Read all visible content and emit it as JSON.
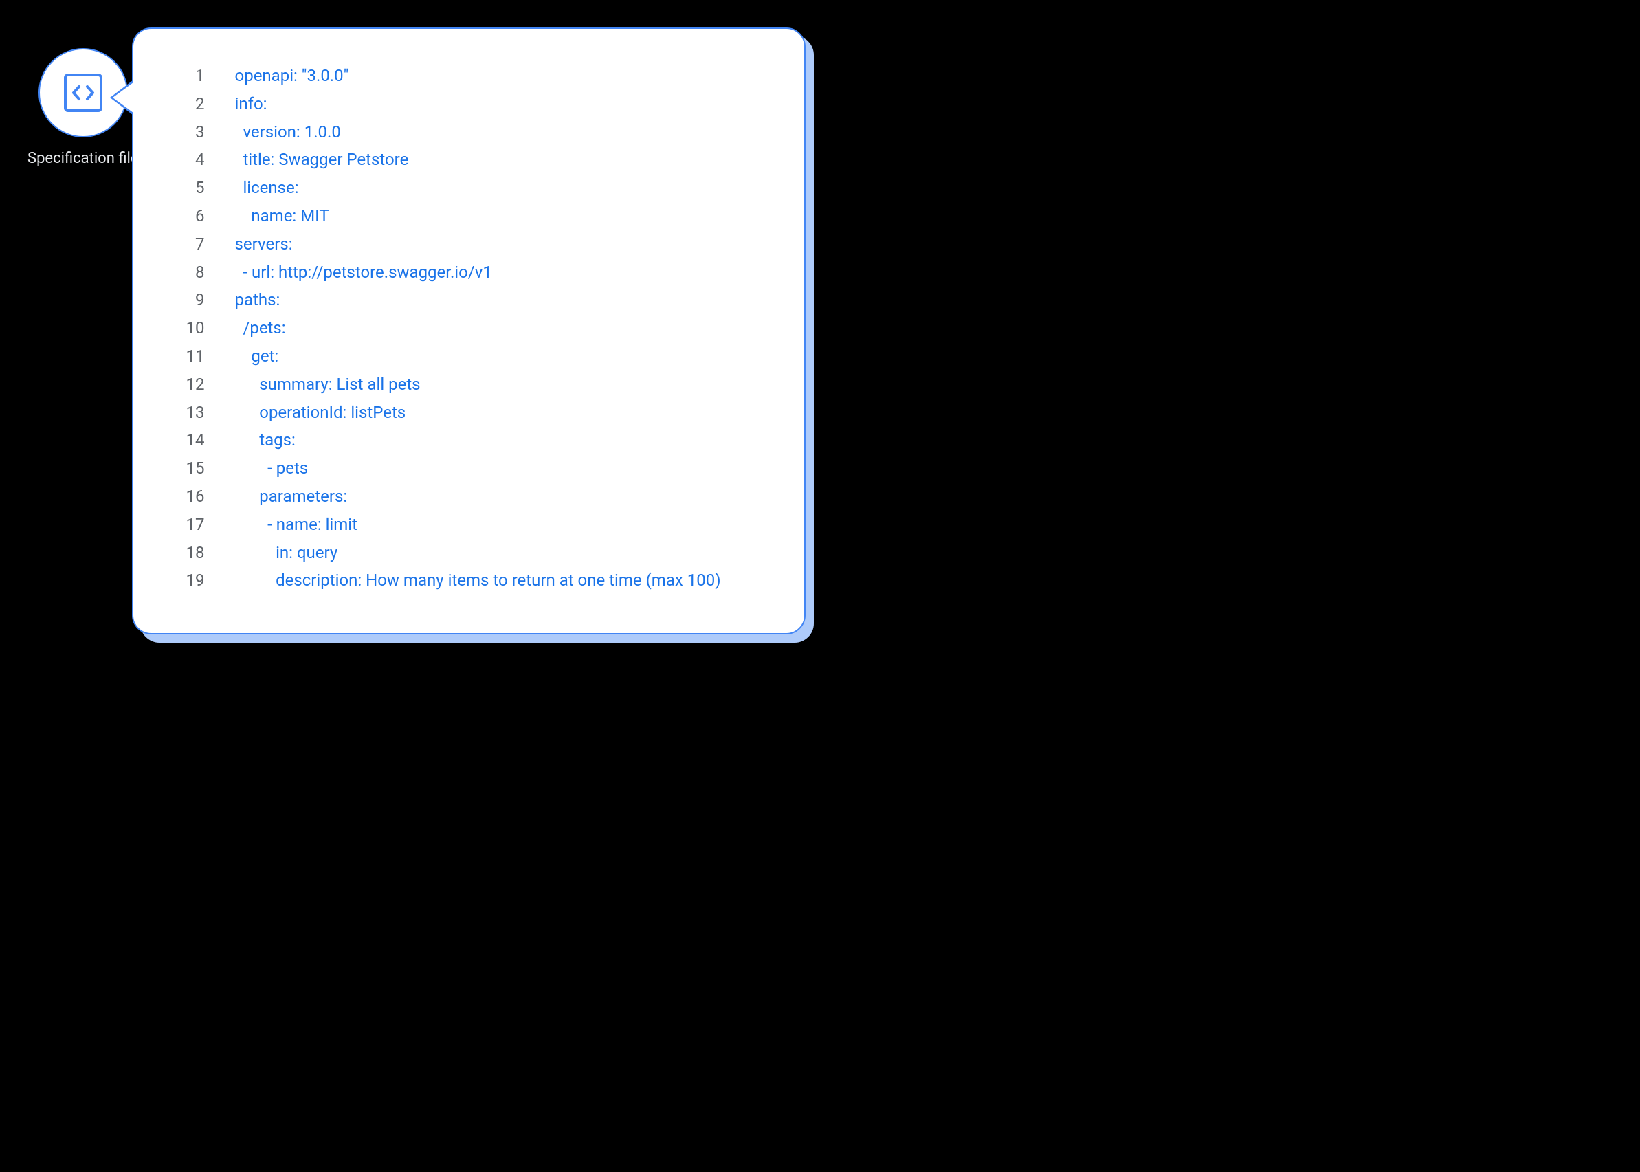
{
  "label": "Specification file",
  "code_lines": [
    {
      "num": "1",
      "indent": 0,
      "text": "openapi: \"3.0.0\""
    },
    {
      "num": "2",
      "indent": 0,
      "text": "info:"
    },
    {
      "num": "3",
      "indent": 1,
      "text": "version: 1.0.0"
    },
    {
      "num": "4",
      "indent": 1,
      "text": "title: Swagger Petstore"
    },
    {
      "num": "5",
      "indent": 1,
      "text": "license:"
    },
    {
      "num": "6",
      "indent": 2,
      "text": "name: MIT"
    },
    {
      "num": "7",
      "indent": 0,
      "text": "servers:"
    },
    {
      "num": "8",
      "indent": 1,
      "text": "- url: http://petstore.swagger.io/v1"
    },
    {
      "num": "9",
      "indent": 0,
      "text": "paths:"
    },
    {
      "num": "10",
      "indent": 1,
      "text": "/pets:"
    },
    {
      "num": "11",
      "indent": 2,
      "text": "get:"
    },
    {
      "num": "12",
      "indent": 3,
      "text": "summary: List all pets"
    },
    {
      "num": "13",
      "indent": 3,
      "text": "operationId: listPets"
    },
    {
      "num": "14",
      "indent": 3,
      "text": "tags:"
    },
    {
      "num": "15",
      "indent": 4,
      "text": "- pets"
    },
    {
      "num": "16",
      "indent": 3,
      "text": "parameters:"
    },
    {
      "num": "17",
      "indent": 4,
      "text": "- name: limit"
    },
    {
      "num": "18",
      "indent": 5,
      "text": "in: query"
    },
    {
      "num": "19",
      "indent": 5,
      "text": "description: How many items to return at one time (max 100)"
    }
  ]
}
